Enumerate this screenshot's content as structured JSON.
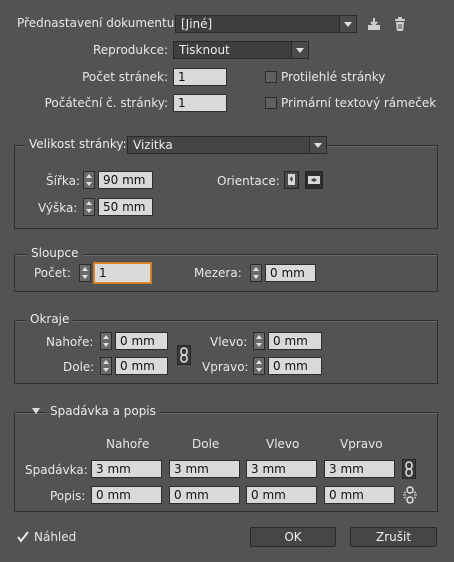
{
  "top": {
    "preset_label": "Přednastavení dokumentu:",
    "preset_value": "[Jiné]",
    "intent_label": "Reprodukce:",
    "intent_value": "Tisknout",
    "pages_label": "Počet stránek:",
    "pages_value": "1",
    "start_label": "Počáteční č. stránky:",
    "start_value": "1",
    "facing_label": "Protilehlé stránky",
    "facing_checked": false,
    "primary_label": "Primární textový rámeček",
    "primary_checked": false
  },
  "page_size": {
    "label": "Velikost stránky:",
    "value": "Vizitka",
    "width_label": "Šířka:",
    "width_value": "90 mm",
    "height_label": "Výška:",
    "height_value": "50 mm",
    "orientation_label": "Orientace:"
  },
  "columns": {
    "title": "Sloupce",
    "count_label": "Počet:",
    "count_value": "1",
    "gutter_label": "Mezera:",
    "gutter_value": "0 mm"
  },
  "margins": {
    "title": "Okraje",
    "top_label": "Nahoře:",
    "top_value": "0 mm",
    "bottom_label": "Dole:",
    "bottom_value": "0 mm",
    "left_label": "Vlevo:",
    "left_value": "0 mm",
    "right_label": "Vpravo:",
    "right_value": "0 mm"
  },
  "bleed": {
    "title": "Spadávka a popis",
    "headers": [
      "Nahoře",
      "Dole",
      "Vlevo",
      "Vpravo"
    ],
    "bleed_label": "Spadávka:",
    "bleed_values": [
      "3 mm",
      "3 mm",
      "3 mm",
      "3 mm"
    ],
    "slug_label": "Popis:",
    "slug_values": [
      "0 mm",
      "0 mm",
      "0 mm",
      "0 mm"
    ]
  },
  "footer": {
    "preview_label": "Náhled",
    "preview_checked": true,
    "ok_label": "OK",
    "cancel_label": "Zrušit"
  },
  "colors": {
    "background": "#535353",
    "field": "#d9d9d9",
    "focus": "#e08a2c"
  },
  "icons": [
    "save-preset-icon",
    "trash-icon",
    "portrait-icon",
    "landscape-icon",
    "chain-link-icon",
    "chain-broken-icon",
    "checkmark-icon",
    "triangle-down-icon"
  ]
}
